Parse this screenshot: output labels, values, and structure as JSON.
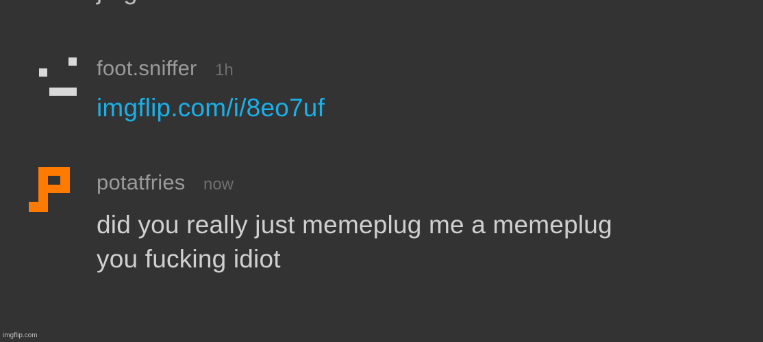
{
  "previous_comment": {
    "text_fragment": "jdtgz"
  },
  "comments": [
    {
      "username": "foot.sniffer",
      "timestamp": "1h",
      "link_text": "imgflip.com/i/8eo7uf",
      "avatar_icon": "pixel-face-icon",
      "avatar_color": "#d9d9d9"
    },
    {
      "username": "potatfries",
      "timestamp": "now",
      "text_line_1": "did you really just memeplug me a memeplug",
      "text_line_2": "you fucking idiot",
      "avatar_icon": "pixel-p-icon",
      "avatar_color": "#ff7a00"
    }
  ],
  "colors": {
    "background": "#333333",
    "link": "#1ab0ea",
    "username": "#9a9a9a",
    "timestamp": "#6f6f6f",
    "body_text": "#d0d0d0"
  },
  "watermark": "imgflip.com"
}
